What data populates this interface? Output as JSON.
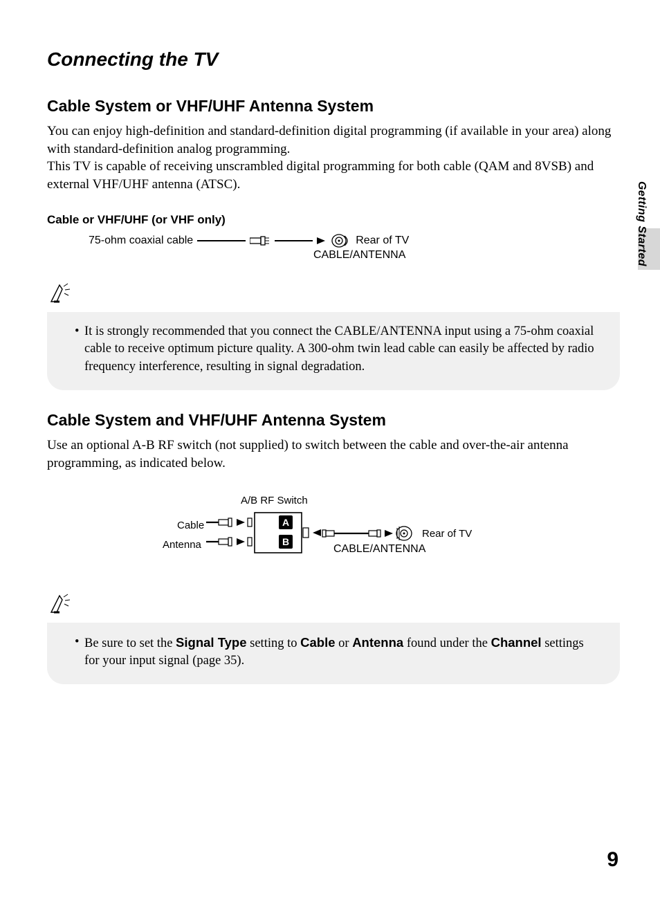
{
  "side_label": "Getting Started",
  "title": "Connecting the TV",
  "section1": {
    "heading": "Cable System or VHF/UHF Antenna System",
    "para1": "You can enjoy high-definition and standard-definition digital programming (if available in your area) along with standard-definition analog programming.",
    "para2": "This TV is capable of receiving unscrambled digital programming for both cable (QAM and 8VSB) and external VHF/UHF antenna (ATSC).",
    "sublabel": "Cable or VHF/UHF (or VHF only)",
    "diagram": {
      "coax": "75-ohm coaxial cable",
      "rear": "Rear of TV",
      "port": "CABLE/ANTENNA"
    },
    "note": "It is strongly recommended that you connect the CABLE/ANTENNA input using a 75-ohm coaxial cable to receive optimum picture quality. A 300-ohm twin lead cable can easily be affected by radio frequency interference, resulting in signal degradation."
  },
  "section2": {
    "heading": "Cable System and VHF/UHF Antenna System",
    "para": "Use an optional A-B RF switch (not supplied) to switch between the cable and over-the-air antenna programming, as indicated below.",
    "diagram": {
      "switch": "A/B RF Switch",
      "cable": "Cable",
      "antenna": "Antenna",
      "a": "A",
      "b": "B",
      "rear": "Rear of TV",
      "port": "CABLE/ANTENNA"
    },
    "note_parts": {
      "t1": "Be sure to set the ",
      "b1": "Signal Type",
      "t2": " setting to ",
      "b2": "Cable",
      "t3": " or ",
      "b3": "Antenna",
      "t4": " found under the ",
      "b4": "Channel",
      "t5": " settings for your input signal (page 35)."
    }
  },
  "page_number": "9"
}
